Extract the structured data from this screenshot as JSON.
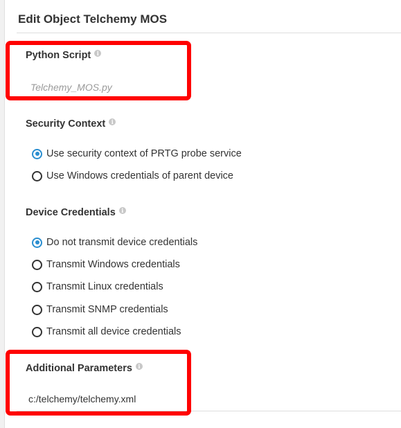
{
  "page": {
    "title": "Edit Object Telchemy MOS"
  },
  "python_script": {
    "label": "Python Script",
    "value": "Telchemy_MOS.py"
  },
  "security_context": {
    "label": "Security Context",
    "options": [
      {
        "label": "Use security context of PRTG probe service",
        "selected": true
      },
      {
        "label": "Use Windows credentials of parent device",
        "selected": false
      }
    ]
  },
  "device_credentials": {
    "label": "Device Credentials",
    "options": [
      {
        "label": "Do not transmit device credentials",
        "selected": true
      },
      {
        "label": "Transmit Windows credentials",
        "selected": false
      },
      {
        "label": "Transmit Linux credentials",
        "selected": false
      },
      {
        "label": "Transmit SNMP credentials",
        "selected": false
      },
      {
        "label": "Transmit all device credentials",
        "selected": false
      }
    ]
  },
  "additional_parameters": {
    "label": "Additional Parameters",
    "value": "c:/telchemy/telchemy.xml"
  },
  "colors": {
    "accent": "#2a8ed0",
    "highlight": "#ff0000",
    "info_icon": "#c8c8c8"
  },
  "icons": {
    "info": "info-icon",
    "radio": "radio-button"
  }
}
